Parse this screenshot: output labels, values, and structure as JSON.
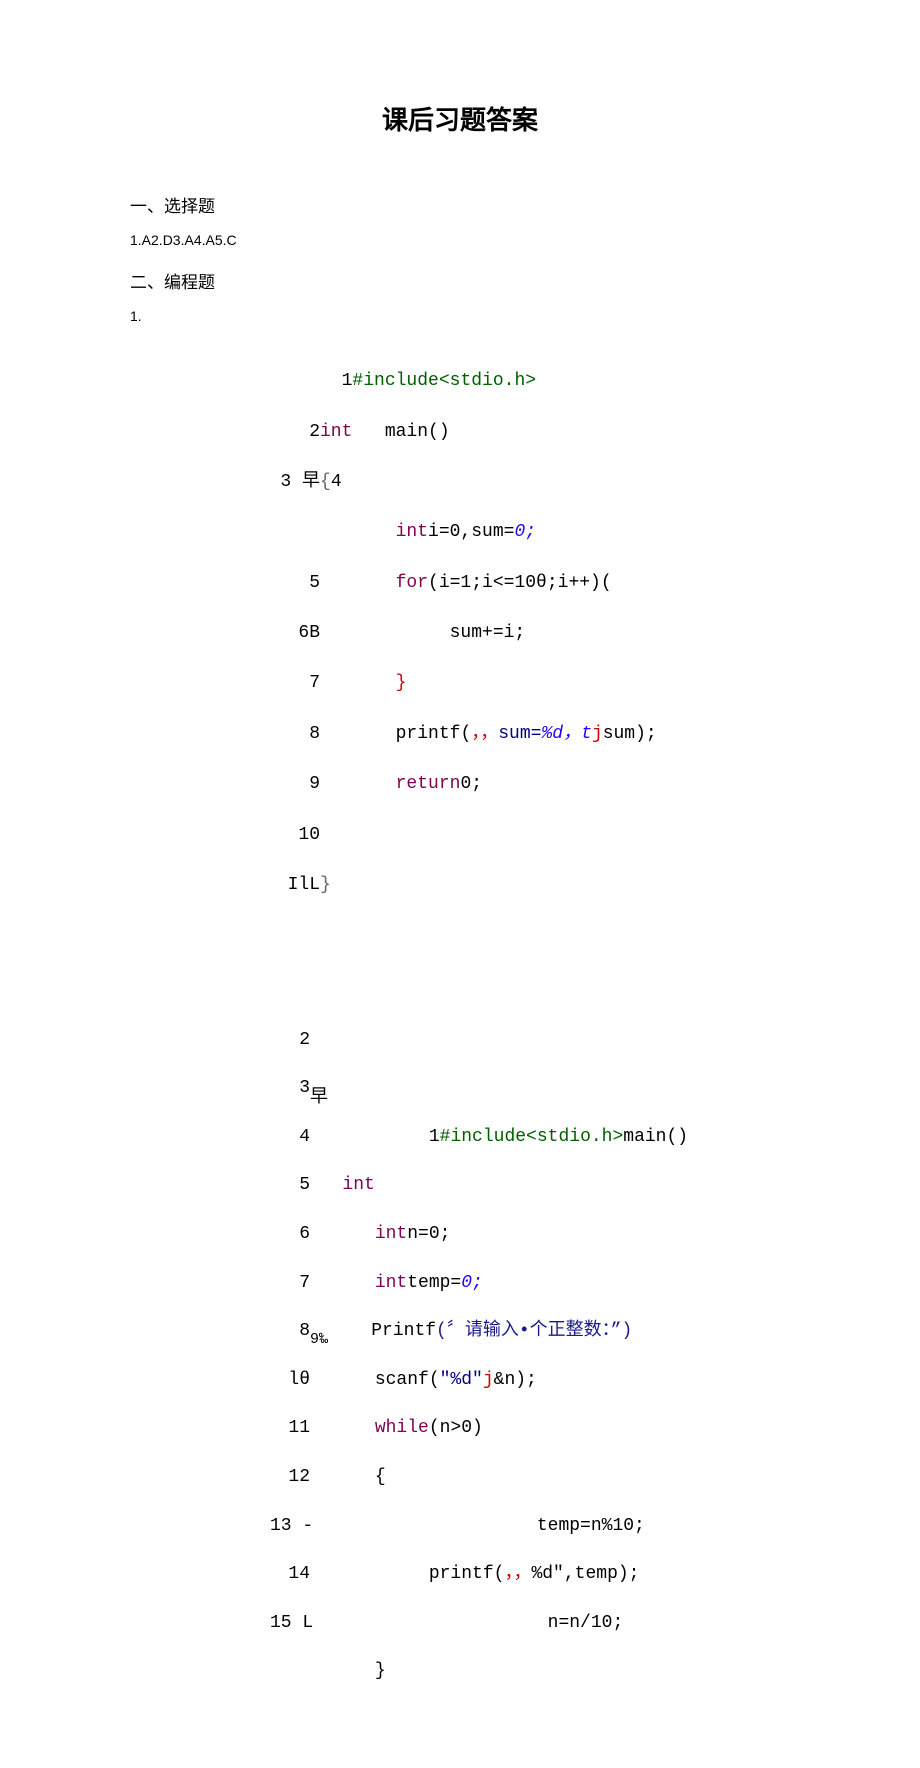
{
  "title": "课后习题答案",
  "section1": {
    "heading": "一、选择题",
    "answers": "1.A2.D3.A4.A5.C"
  },
  "section2": {
    "heading": "二、编程题",
    "item1": "1."
  },
  "code1": {
    "l1": {
      "n": "1",
      "a": "#include<stdio.h>"
    },
    "l2": {
      "n": "2",
      "a": "int",
      "b": "main()"
    },
    "l3": {
      "n": "3 早",
      "a": "{",
      "b": "4"
    },
    "l4": {
      "n": "",
      "a": "int",
      "b": "i=0,sum=",
      "c": "0;"
    },
    "l5": {
      "n": "5",
      "a": "for",
      "b": "(i=1;i<=10θ;i++)("
    },
    "l6": {
      "n": "6B",
      "a": "sum+=i;"
    },
    "l7": {
      "n": "7",
      "a": "}"
    },
    "l8": {
      "n": "8",
      "a": "printf",
      "b": "(",
      "c": "，，",
      "d": "sum=",
      "e": "%d，t",
      "f": "j",
      "g": "sum);"
    },
    "l9": {
      "n": "9",
      "a": "return",
      "b": "0;"
    },
    "l10": {
      "n": "10"
    },
    "l11": {
      "n": "IlL",
      "a": "}"
    }
  },
  "code2": {
    "l1": {
      "n": "2"
    },
    "l2": {
      "n": "3",
      "sub": "早"
    },
    "l3": {
      "n": "4",
      "pre": "1",
      "a": "#include<stdio.h>",
      "b": "main()"
    },
    "l4": {
      "n": "5",
      "a": "int"
    },
    "l5": {
      "n": "6",
      "a": "int",
      "b": "n=0;"
    },
    "l6": {
      "n": "7",
      "a": "int",
      "b": "temp=",
      "c": "0;"
    },
    "l7": {
      "n": "8",
      "sub": "9‰",
      "a": "Printf",
      "b": "(",
      "c": "〞",
      "d": "请输入•个正整数：",
      "e": "”)"
    },
    "l8": {
      "n": "lθ",
      "a": "scanf(",
      "b": "\"%d\"",
      "c": "j",
      "d": "&n);"
    },
    "l9": {
      "n": "11",
      "a": "while",
      "b": "(n>0)"
    },
    "l10": {
      "n": "12",
      "a": "{"
    },
    "l11": {
      "n": "13 -",
      "a": "temp=n%10;"
    },
    "l12": {
      "n": "14",
      "a": "printf(",
      "b": "，，",
      "c": "%d\",temp);"
    },
    "l13": {
      "n": "15 L",
      "a": "n=n/10;"
    },
    "l14": {
      "n": "",
      "a": "}"
    }
  }
}
